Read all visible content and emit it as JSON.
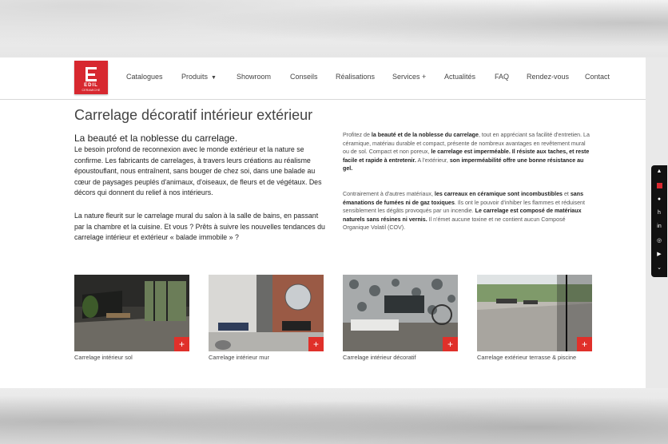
{
  "brand": {
    "name": "EDIL",
    "tagline": "CERAMICHE"
  },
  "nav": [
    {
      "label": "Catalogues"
    },
    {
      "label": "Produits",
      "dropdown": true
    },
    {
      "label": "Showroom"
    },
    {
      "label": "Conseils"
    },
    {
      "label": "Réalisations"
    },
    {
      "label": "Services +"
    },
    {
      "label": "Actualités"
    },
    {
      "label": "FAQ"
    },
    {
      "label": "Rendez-vous"
    },
    {
      "label": "Contact"
    }
  ],
  "page": {
    "title": "Carrelage décoratif intérieur extérieur",
    "lead_heading": "La beauté et la noblesse du carrelage.",
    "lead_paragraph1": "Le besoin profond de reconnexion avec le monde extérieur et la nature se confirme. Les fabricants de carrelages, à travers leurs créations au réalisme époustouflant, nous entraînent, sans bouger de chez soi, dans une balade au cœur de paysages peuplés d'animaux, d'oiseaux, de fleurs et de végétaux. Des décors qui donnent du relief à nos intérieurs.",
    "lead_paragraph2": "La nature fleurit sur le carrelage mural du salon à la salle de bains, en passant par la chambre et la cuisine. Et vous ? Prêts à suivre les nouvelles tendances du carrelage intérieur et extérieur « balade immobile » ?",
    "right_p1": [
      {
        "t": "Profitez de ",
        "b": false
      },
      {
        "t": "la beauté et de la noblesse du carrelage",
        "b": true
      },
      {
        "t": ", tout en appréciant sa facilité d'entretien. La céramique, matériau durable et compact, présente de nombreux avantages en revêtement mural ou de sol. Compact et non poreux, ",
        "b": false
      },
      {
        "t": "le carrelage est imperméable. Il résiste aux taches, et reste facile et rapide à entretenir.",
        "b": true
      },
      {
        "t": " A l'extérieur, ",
        "b": false
      },
      {
        "t": "son imperméabilité offre une bonne résistance au gel.",
        "b": true
      }
    ],
    "right_p2": [
      {
        "t": "Contrairement à d'autres matériaux, ",
        "b": false
      },
      {
        "t": "les carreaux en céramique sont incombustibles",
        "b": true
      },
      {
        "t": " et ",
        "b": false
      },
      {
        "t": "sans émanations de fumées ni de gaz toxiques",
        "b": true
      },
      {
        "t": ". Ils ont le pouvoir d'inhiber les flammes et réduisent sensiblement les dégâts provoqués par un incendie. ",
        "b": false
      },
      {
        "t": "Le carrelage est composé de matériaux naturels sans résines ni vernis.",
        "b": true
      },
      {
        "t": " Il n'émet aucune toxine et ne contient aucun Composé Organique Volatil (COV).",
        "b": false
      }
    ]
  },
  "cards": [
    {
      "caption": "Carrelage intérieur sol",
      "plus": "+"
    },
    {
      "caption": "Carrelage intérieur mur",
      "plus": "+"
    },
    {
      "caption": "Carrelage intérieur décoratif",
      "plus": "+"
    },
    {
      "caption": "Carrelage extérieur terrasse & piscine",
      "plus": "+"
    }
  ],
  "social_icons": [
    "arrow-up-icon",
    "red-square-icon",
    "facebook-icon",
    "houzz-icon",
    "linkedin-icon",
    "instagram-icon",
    "youtube-icon",
    "chevron-down-icon"
  ],
  "colors": {
    "accent": "#d7282f",
    "plus_button": "#e0302a"
  }
}
